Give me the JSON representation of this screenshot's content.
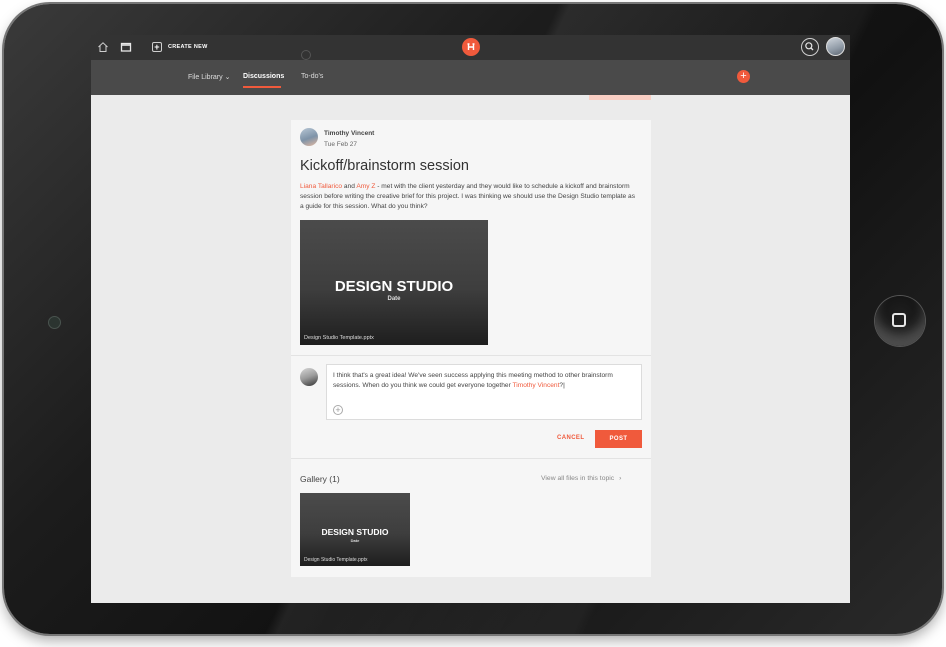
{
  "header": {
    "create_new_label": "CREATE NEW"
  },
  "nav": {
    "tabs": [
      {
        "label": "File Library ⌄"
      },
      {
        "label": "Discussions",
        "active": true
      },
      {
        "label": "To-do's"
      }
    ]
  },
  "post": {
    "author": "Timothy Vincent",
    "date": "Tue Feb 27",
    "title": "Kickoff/brainstorm session",
    "mention_1": "Liana Tallarico",
    "and_word": "and",
    "mention_2": "Amy Z",
    "body": "- met with the client yesterday and they would like to schedule a kickoff and brainstorm session before writing the creative brief for this project. I was thinking we should use the Design Studio template as a guide for this session. What do you think?",
    "attachment": {
      "title": "DESIGN STUDIO",
      "subtitle": "Date",
      "filename": "Design Studio Template.pptx"
    }
  },
  "reply": {
    "text": "I think that's a great idea! We've seen success applying this meeting method to other brainstorm sessions. When do you think we could get everyone together",
    "mention": "Timothy Vincent",
    "trailing": "?",
    "cancel_label": "CANCEL",
    "post_label": "POST"
  },
  "gallery": {
    "title": "Gallery (1)",
    "view_all": "View all files in this topic",
    "items": [
      {
        "title": "DESIGN STUDIO",
        "subtitle": "Date",
        "filename": "Design Studio Template.pptx"
      }
    ]
  },
  "colors": {
    "accent": "#f05a3c",
    "topbar": "#333333",
    "navbar": "#4a4a4a",
    "background": "#ebebeb"
  },
  "icons": {
    "home": "home-icon",
    "window": "window-icon",
    "add": "plus-icon",
    "logo": "brand-logo-icon",
    "search": "search-icon",
    "chevron": "chevron-right-icon"
  }
}
